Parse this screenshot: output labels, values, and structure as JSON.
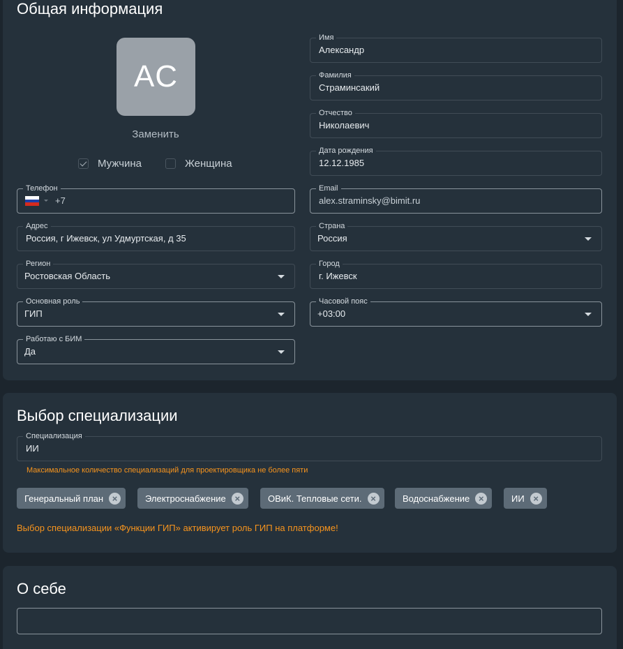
{
  "general": {
    "title": "Общая информация",
    "avatar_initials": "AC",
    "replace_label": "Заменить",
    "gender": {
      "male_label": "Мужчина",
      "female_label": "Женщина",
      "selected": "male"
    },
    "fields": {
      "first_name": {
        "label": "Имя",
        "value": "Александр"
      },
      "last_name": {
        "label": "Фамилия",
        "value": "Страминсакий"
      },
      "patronymic": {
        "label": "Отчество",
        "value": "Николаевич"
      },
      "birth_date": {
        "label": "Дата рождения",
        "value": "12.12.1985"
      },
      "phone": {
        "label": "Телефон",
        "value": "+7",
        "country_flag": "russia-flag-icon"
      },
      "email": {
        "label": "Email",
        "value": "alex.straminsky@bimit.ru"
      },
      "address": {
        "label": "Адрес",
        "value": "Россия, г Ижевск, ул Удмуртская, д 35"
      },
      "country": {
        "label": "Страна",
        "value": "Россия"
      },
      "region": {
        "label": "Регион",
        "value": "Ростовская Область"
      },
      "city": {
        "label": "Город",
        "value": "г. Ижевск"
      },
      "main_role": {
        "label": "Основная роль",
        "value": "ГИП"
      },
      "timezone": {
        "label": "Часовой пояс",
        "value": "+03:00"
      },
      "bim": {
        "label": "Работаю с БИМ",
        "value": "Да"
      }
    }
  },
  "specialization": {
    "title": "Выбор специализации",
    "field_label": "Специализация",
    "field_value": "ИИ",
    "hint": "Максимальное количество специализаций для проектировщика не более пяти",
    "chips": [
      "Генеральный план",
      "Электроснабжение",
      "ОВиК. Тепловые сети.",
      "Водоснабжение",
      "ИИ"
    ],
    "warning": "Выбор специализации «Функции ГИП» активирует роль ГИП на платформе!"
  },
  "about": {
    "title": "О себе",
    "value": ""
  },
  "colors": {
    "background": "#1c252d",
    "card": "#25313b",
    "accent_warning": "#f7941d",
    "chip": "#5d6b77"
  }
}
